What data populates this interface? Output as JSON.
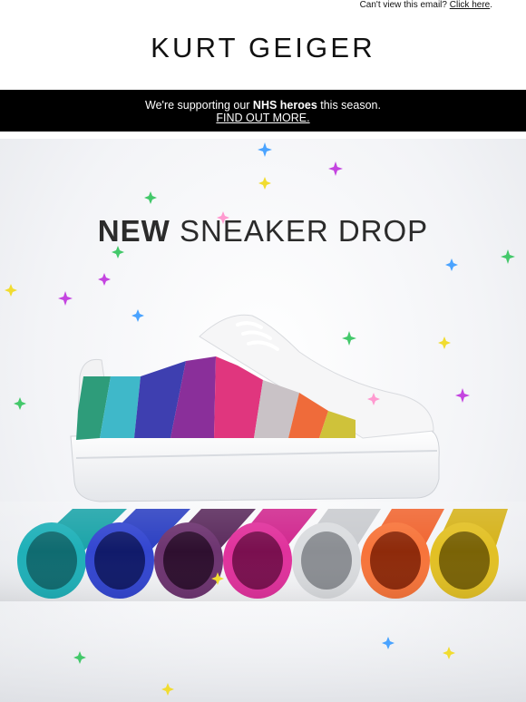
{
  "preheader": {
    "text": "Can't view this email?",
    "link": "Click here",
    "suffix": "."
  },
  "brand": {
    "logo_text": "KURT GEIGER"
  },
  "banner": {
    "prefix": "We're supporting our ",
    "highlight": "NHS heroes",
    "suffix": " this season.",
    "cta": "FIND OUT MORE."
  },
  "hero": {
    "title_bold": "NEW",
    "title_light": " SNEAKER DROP",
    "image_alt": "Rainbow crystal striped sneaker on coloured tubes"
  },
  "colors": {
    "banner_bg": "#000000",
    "stripe_1": "#3fb8c9",
    "stripe_2": "#3e3fb0",
    "stripe_3": "#8a2f9a",
    "stripe_4": "#e0367e",
    "stripe_5": "#c9c2c6",
    "stripe_6": "#ef6b3a",
    "stripe_7": "#cfc23a"
  }
}
